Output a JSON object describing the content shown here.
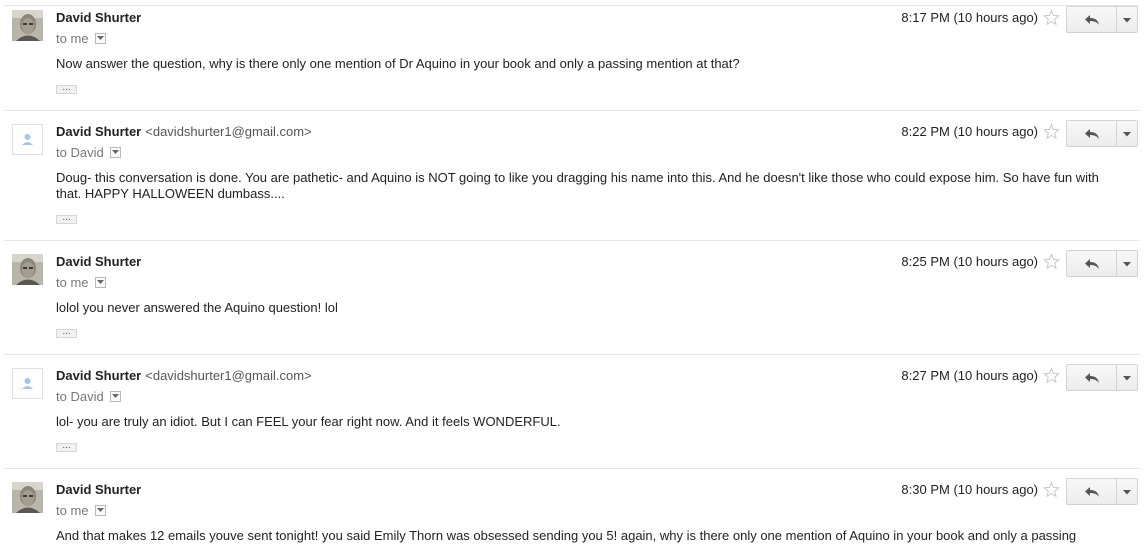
{
  "messages": [
    {
      "sender_name": "David Shurter",
      "sender_email": "",
      "avatar": "photo",
      "recipient": "to me",
      "time": "8:17 PM (10 hours ago)",
      "body": "Now answer the question, why is there only one mention of Dr Aquino in your book and only a passing mention at that?",
      "trimmed_content_label": "..."
    },
    {
      "sender_name": "David Shurter",
      "sender_email": "<davidshurter1@gmail.com>",
      "avatar": "generic",
      "recipient": "to David",
      "time": "8:22 PM (10 hours ago)",
      "body": "Doug- this conversation is done.  You are pathetic- and Aquino is NOT going to like you dragging his name into this.  And he doesn't like those who could expose him.  So have fun with that.  HAPPY HALLOWEEN dumbass....",
      "trimmed_content_label": "..."
    },
    {
      "sender_name": "David Shurter",
      "sender_email": "",
      "avatar": "photo",
      "recipient": "to me",
      "time": "8:25 PM (10 hours ago)",
      "body": "lolol you never answered the Aquino question! lol",
      "trimmed_content_label": "..."
    },
    {
      "sender_name": "David Shurter",
      "sender_email": "<davidshurter1@gmail.com>",
      "avatar": "generic",
      "recipient": "to David",
      "time": "8:27 PM (10 hours ago)",
      "body": "lol- you are truly an idiot.  But I can FEEL your fear right now.  And it feels WONDERFUL.",
      "trimmed_content_label": "..."
    },
    {
      "sender_name": "David Shurter",
      "sender_email": "",
      "avatar": "photo",
      "recipient": "to me",
      "time": "8:30 PM (10 hours ago)",
      "body": "And that makes 12 emails youve sent tonight! you said Emily Thorn was obsessed sending you 5! again, why is there only one mention of Aquino in your book and only a passing",
      "trimmed_content_label": ""
    }
  ],
  "icons": {
    "star": "star-outline-icon",
    "reply": "reply-arrow-icon",
    "more": "dropdown-arrow-icon",
    "recipient_details": "show-details-icon",
    "generic_avatar": "person-silhouette-icon"
  },
  "colors": {
    "divider": "#e5e5e5",
    "text": "#222222",
    "muted": "#777777",
    "generic_avatar": "#a8c4e8"
  }
}
